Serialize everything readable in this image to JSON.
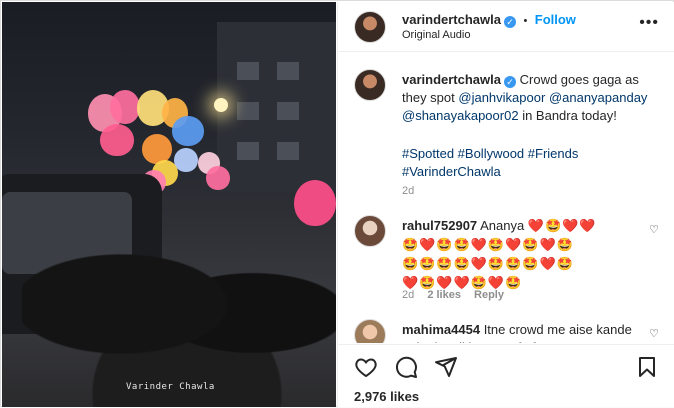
{
  "header": {
    "username": "varindertchawla",
    "follow_label": "Follow",
    "separator": "•",
    "audio": "Original Audio",
    "more_icon": "more-horizontal-icon"
  },
  "caption": {
    "username": "varindertchawla",
    "text_intro": "Crowd goes gaga as they spot",
    "mention_1": "@janhvikapoor",
    "mention_2": "@ananyapanday",
    "mention_3": "@shanayakapoor02",
    "text_outro": "in Bandra today!",
    "hashtags": [
      "#Spotted",
      "#Bollywood",
      "#Friends",
      "#VarinderChawla"
    ],
    "time": "2d"
  },
  "comments": [
    {
      "username": "rahul752907",
      "text": "Ananya",
      "emoji_line_1": "❤️🤩❤️❤️",
      "emoji_line_2": "🤩❤️🤩🤩❤️🤩❤️🤩❤️🤩",
      "emoji_line_3": "🤩🤩🤩🤩❤️🤩🤩🤩❤️🤩",
      "emoji_line_4": "❤️🤩❤️❤️🤩❤️🤩",
      "time": "2d",
      "likes": "2 likes",
      "reply": "Reply"
    },
    {
      "username": "mahima4454",
      "text": "Itne crowd me aise kande pehn ke nikla not safe for"
    }
  ],
  "media": {
    "watermark": "Varinder Chawla"
  },
  "actions": {
    "likes_count": "2,976 likes"
  },
  "colors": {
    "link_blue": "#0095f6",
    "verified_blue": "#3897f0",
    "tag_blue": "#00376b",
    "meta_gray": "#8e8e8e"
  }
}
